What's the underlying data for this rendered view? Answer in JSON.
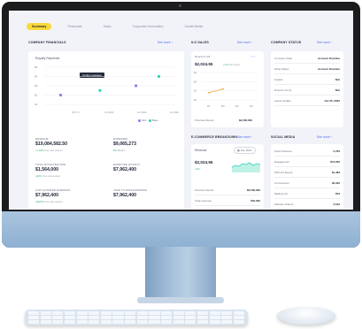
{
  "tabs": [
    "Summary",
    "Financials",
    "Sales",
    "Corporate Information",
    "Social Media"
  ],
  "company_financials": {
    "title": "COMPANY FINANCIALS",
    "see_more": "See more",
    "chart_title": "Royalty Payments",
    "tooltip": "Tooltip message",
    "y_ticks": [
      "$5",
      "$4",
      "$3",
      "$2",
      "$1"
    ],
    "x_ticks": [
      "OCT 1",
      "11 2021",
      "12 2021",
      "13 2021"
    ],
    "legend": [
      "Slot",
      "Base"
    ],
    "colors": {
      "purple": "#8d7cf0",
      "teal": "#2ed3b7",
      "green": "#2bb673",
      "orange": "#f39c3d"
    },
    "chart_data": {
      "type": "scatter",
      "series": [
        {
          "name": "Slot",
          "points": [
            [
              0.5,
              2
            ],
            [
              2.8,
              3
            ]
          ]
        },
        {
          "name": "Base",
          "points": [
            [
              1.7,
              2.5
            ],
            [
              3.5,
              4
            ]
          ]
        }
      ],
      "ylim": [
        1,
        5
      ]
    },
    "metrics": [
      {
        "label": "REVENUE",
        "value": "$19,084,582.50",
        "change": "+1.82%",
        "note": "from last quarter"
      },
      {
        "label": "EXPENSES",
        "value": "$9,065,273",
        "change": "8%",
        "note": "Margin"
      },
      {
        "label": "TOTAL ROYALTIES PAID",
        "value": "$1,564,000",
        "change": "+$2%",
        "note": "from last quarter"
      },
      {
        "label": "EXPECTED ROYALTY",
        "value": "$7,962,400",
        "change": "",
        "note": ""
      },
      {
        "label": "LAST QUARTER EARNINGS",
        "value": "$7,962,400",
        "change": "+$8.5%",
        "note": "from last quarter"
      },
      {
        "label": "YEAR TO DATE EARNINGS",
        "value": "$7,962,400",
        "change": "",
        "note": ""
      }
    ]
  },
  "ilo_sales": {
    "title": "ILO SALES",
    "see_more": "See more",
    "round_label": "Round 3 of 8",
    "value": "$2,024.55",
    "change": "+1%",
    "change_note": "last round",
    "y_ticks": [
      "$4",
      "$3",
      "$2",
      "$1"
    ],
    "x_ticks": [
      "R1",
      "R2",
      "R3",
      "R4"
    ],
    "line_points": [
      [
        1,
        1.8
      ],
      [
        2,
        2.2
      ]
    ],
    "ylim": [
      1,
      4
    ],
    "previous_round_label": "Previous Round",
    "previous_round_value": "$2,500,000"
  },
  "ecommerce": {
    "title": "E-COMMERCE BREAKDOWN",
    "see_more": "See more",
    "revenue_label": "Revenue",
    "period": "Nov 2021",
    "value": "$2,024.55",
    "change": "+3%",
    "rows": [
      {
        "label": "Previous Round",
        "value": "$2,500,000"
      },
      {
        "label": "Total Licenses",
        "value": "500,000"
      }
    ]
  },
  "company_status": {
    "title": "COMPANY STATUS",
    "see_more": "See more",
    "rows": [
      {
        "label": "Company Data",
        "value": "Account Overdue"
      },
      {
        "label": "Filing Status",
        "value": "Account Overdue"
      },
      {
        "label": "Capital",
        "value": "N/A"
      },
      {
        "label": "Director Count",
        "value": "N/A"
      },
      {
        "label": "Latest Update",
        "value": "Oct 26, 2020"
      }
    ]
  },
  "social_media": {
    "title": "SOCIAL MEDIA",
    "see_more": "See more",
    "rows": [
      {
        "label": "Total Followers",
        "value": "2,763"
      },
      {
        "label": "Engagement",
        "value": "873,000"
      },
      {
        "label": "MTD Ad Spend",
        "value": "$1,483"
      },
      {
        "label": "Conversions",
        "value": "36,346"
      },
      {
        "label": "Mailing List",
        "value": "873"
      },
      {
        "label": "Website Visitors",
        "value": "3,542"
      }
    ]
  }
}
